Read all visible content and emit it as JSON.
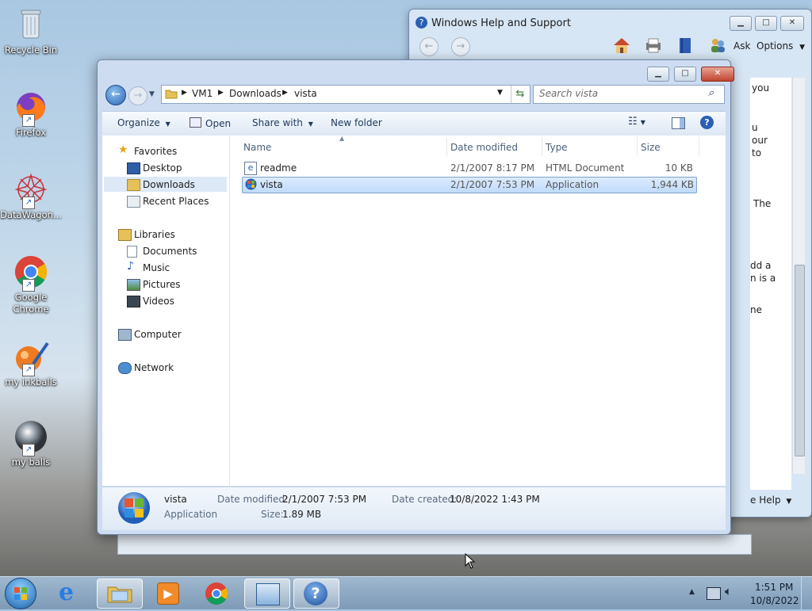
{
  "desktop": {
    "icons": [
      {
        "label": "Recycle Bin"
      },
      {
        "label": "Firefox"
      },
      {
        "label": "DataWagon..."
      },
      {
        "label": "Google Chrome"
      },
      {
        "label": "my inkballs"
      },
      {
        "label": "my balls"
      }
    ]
  },
  "help_window": {
    "title": "Windows Help and Support",
    "ask_label": "Ask",
    "options_label": "Options",
    "more_help_label": "e Help",
    "partial_text": [
      "you",
      "u",
      "our",
      "to",
      "The",
      "dd a",
      "n is a",
      "ne"
    ]
  },
  "explorer": {
    "breadcrumb": [
      "VM1",
      "Downloads",
      "vista"
    ],
    "search_placeholder": "Search vista",
    "toolbar": {
      "organize": "Organize",
      "open": "Open",
      "share_with": "Share with",
      "new_folder": "New folder"
    },
    "nav": {
      "favorites": "Favorites",
      "desktop": "Desktop",
      "downloads": "Downloads",
      "recent_places": "Recent Places",
      "libraries": "Libraries",
      "documents": "Documents",
      "music": "Music",
      "pictures": "Pictures",
      "videos": "Videos",
      "computer": "Computer",
      "network": "Network"
    },
    "columns": {
      "name": "Name",
      "date_modified": "Date modified",
      "type": "Type",
      "size": "Size"
    },
    "files": [
      {
        "name": "readme",
        "date_modified": "2/1/2007 8:17 PM",
        "type": "HTML Document",
        "size": "10 KB"
      },
      {
        "name": "vista",
        "date_modified": "2/1/2007 7:53 PM",
        "type": "Application",
        "size": "1,944 KB"
      }
    ],
    "details": {
      "name": "vista",
      "kind": "Application",
      "date_modified_label": "Date modified:",
      "date_modified_value": "2/1/2007 7:53 PM",
      "date_created_label": "Date created:",
      "date_created_value": "10/8/2022 1:43 PM",
      "size_label": "Size:",
      "size_value": "1.89 MB"
    }
  },
  "taskbar": {
    "clock_time": "1:51 PM",
    "clock_date": "10/8/2022"
  },
  "colors": {
    "selection": "#c1dbfc",
    "accent": "#2a5fb3"
  }
}
